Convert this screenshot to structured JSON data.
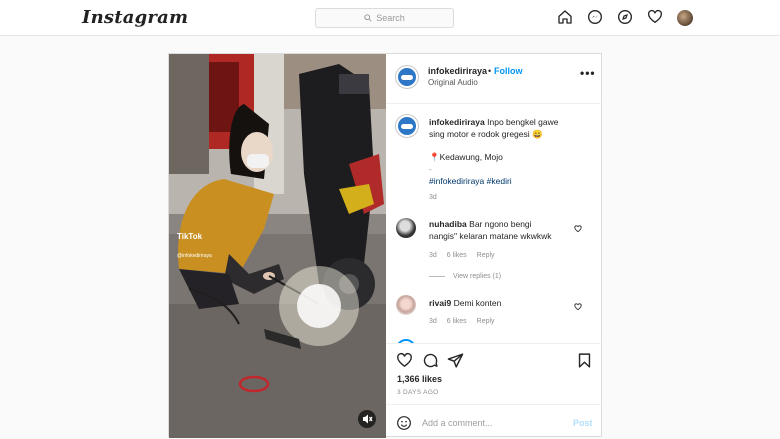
{
  "topbar": {
    "logo": "Instagram",
    "search_placeholder": "Search",
    "nav_icons": [
      "home-icon",
      "messenger-icon",
      "explore-icon",
      "heart-icon",
      "profile-avatar"
    ]
  },
  "post": {
    "author": "infokediriraya",
    "dot": "•",
    "follow_label": "Follow",
    "audio": "Original Audio",
    "more": "•••",
    "caption": {
      "user": "infokediriraya",
      "line1": "Inpo bengkel gawe",
      "line2": "sing motor e rodok gregesi 😄",
      "location": "📍Kedawung, Mojo",
      "dash": "-",
      "hashtags": "#infokediriraya #kediri",
      "time": "3d"
    },
    "comments": [
      {
        "user": "nuhadiba",
        "line1": "Bar ngono bengi",
        "line2": "nangis\" kelaran matane wkwkwk",
        "time": "3d",
        "likes": "6 likes",
        "reply": "Reply",
        "view_replies": "View replies (1)"
      },
      {
        "user": "rivai9",
        "text": "Demi konten",
        "time": "3d",
        "likes": "6 likes",
        "reply": "Reply"
      }
    ],
    "likes_count": "1,366 likes",
    "time_ago": "3 DAYS AGO",
    "add_comment_placeholder": "Add a comment...",
    "post_button": "Post",
    "video_watermark": {
      "brand": "TikTok",
      "handle": "@infokediriraya"
    }
  },
  "colors": {
    "accent": "#0095f6",
    "border": "#dbdbdb",
    "muted": "#8e8e8e"
  }
}
